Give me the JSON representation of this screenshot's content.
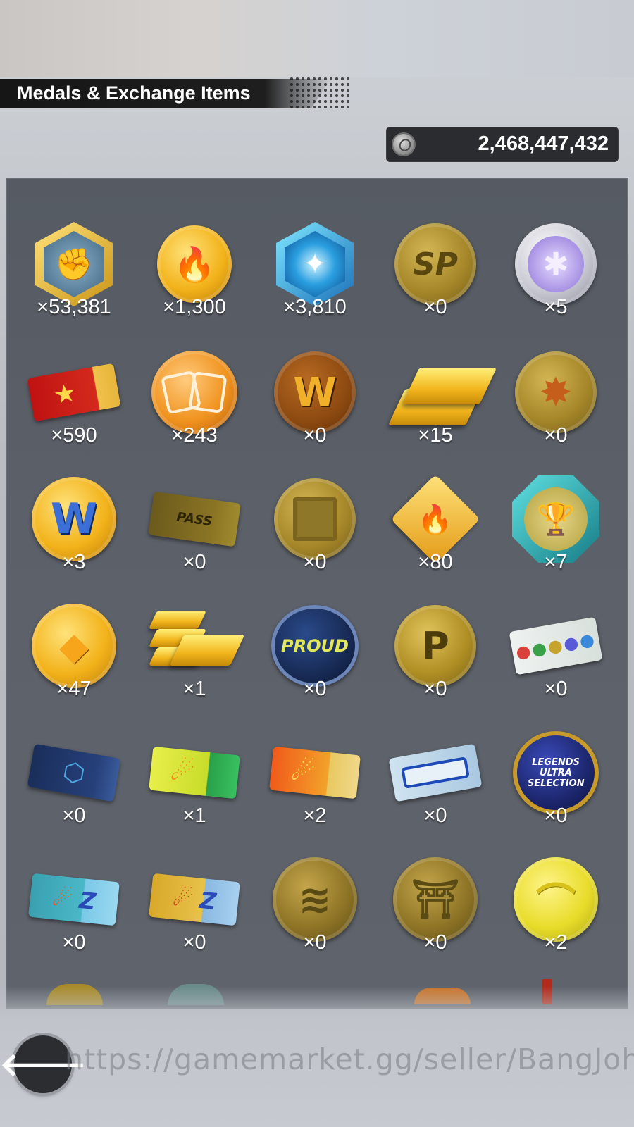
{
  "header": {
    "title": "Medals & Exchange Items",
    "currency": {
      "icon": "zeni-coin-icon",
      "value": "2,468,447,432"
    }
  },
  "items": [
    {
      "icon": "fist-hex-medal-icon",
      "count": "×53,381"
    },
    {
      "icon": "flame-coin-icon",
      "count": "×1,300"
    },
    {
      "icon": "blue-crystal-hex-icon",
      "count": "×3,810"
    },
    {
      "icon": "sp-coin-icon",
      "count": "×0"
    },
    {
      "icon": "silver-star-coin-icon",
      "count": "×5"
    },
    {
      "icon": "red-star-ticket-icon",
      "count": "×590"
    },
    {
      "icon": "card-exchange-coin-icon",
      "count": "×243"
    },
    {
      "icon": "w-coin-icon",
      "count": "×0"
    },
    {
      "icon": "gold-bars-icon",
      "count": "×15"
    },
    {
      "icon": "burst-coin-icon",
      "count": "×0"
    },
    {
      "icon": "w-gold-coin-icon",
      "count": "×3"
    },
    {
      "icon": "legends-pass-ticket-icon",
      "count": "×0"
    },
    {
      "icon": "puzzle-coin-icon",
      "count": "×0"
    },
    {
      "icon": "flame-diamond-medal-icon",
      "count": "×80"
    },
    {
      "icon": "trophy-badge-icon",
      "count": "×7"
    },
    {
      "icon": "gem-coin-icon",
      "count": "×47"
    },
    {
      "icon": "gold-bar-stack-icon",
      "count": "×1"
    },
    {
      "icon": "proud-coin-icon",
      "count": "×0"
    },
    {
      "icon": "p-coin-icon",
      "count": "×0"
    },
    {
      "icon": "gem-ticket-icon",
      "count": "×0"
    },
    {
      "icon": "blue-ticket-icon",
      "count": "×0"
    },
    {
      "icon": "green-meteor-ticket-icon",
      "count": "×1"
    },
    {
      "icon": "sp-meteor-ticket-icon",
      "count": "×2"
    },
    {
      "icon": "blue-frame-ticket-icon",
      "count": "×0"
    },
    {
      "icon": "legends-ultra-selection-coin-icon",
      "count": "×0"
    },
    {
      "icon": "z-teal-ticket-icon",
      "count": "×0"
    },
    {
      "icon": "z-gold-ticket-icon",
      "count": "×0"
    },
    {
      "icon": "bandage-coin-icon",
      "count": "×0"
    },
    {
      "icon": "gi-coin-icon",
      "count": "×0"
    },
    {
      "icon": "yellow-cape-coin-icon",
      "count": "×2"
    }
  ],
  "coin_labels": {
    "sp": "SP",
    "w": "W",
    "proud": "PROUD",
    "p": "P",
    "legends": "LEGENDS ULTRA SELECTION",
    "pass": "PASS",
    "z": "Z"
  },
  "footer": {
    "back_icon": "back-arrow-icon",
    "watermark": "https://gamemarket.gg/seller/BangJohn"
  },
  "colors": {
    "panel": "#5d6169",
    "gold": "#f2b21a",
    "bronze": "#a68729"
  }
}
